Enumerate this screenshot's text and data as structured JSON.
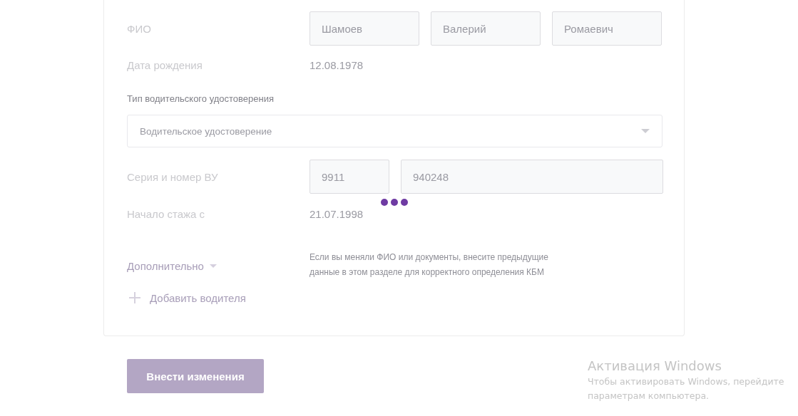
{
  "driver": {
    "fio": {
      "label": "ФИО",
      "fields": [
        {
          "value": "Шамоев"
        },
        {
          "value": "Валерий"
        },
        {
          "value": "Ромаевич"
        }
      ]
    },
    "birth_date": {
      "label": "Дата рождения",
      "value": "12.08.1978"
    },
    "license_type": {
      "label": "Тип водительского удостоверения",
      "value": "Водительское удостоверение"
    },
    "license_number": {
      "label": "Серия и номер ВУ",
      "series": "9911",
      "number": "940248"
    },
    "loading": true,
    "experience_start": {
      "label": "Начало стажа с",
      "value": "21.07.1998"
    },
    "additional": {
      "label": "Дополнительно",
      "expanded": false,
      "note": "Если вы меняли ФИО или документы, внесите предыдущие данные в этом разделе для корректного определения КБМ"
    },
    "add_driver": "Добавить водителя"
  },
  "submit_button": "Внести изменения",
  "os_notice": {
    "title": "Активация Windows",
    "lines": [
      "Чтобы активировать Windows, перейдите",
      "параметрам компьютера."
    ]
  }
}
